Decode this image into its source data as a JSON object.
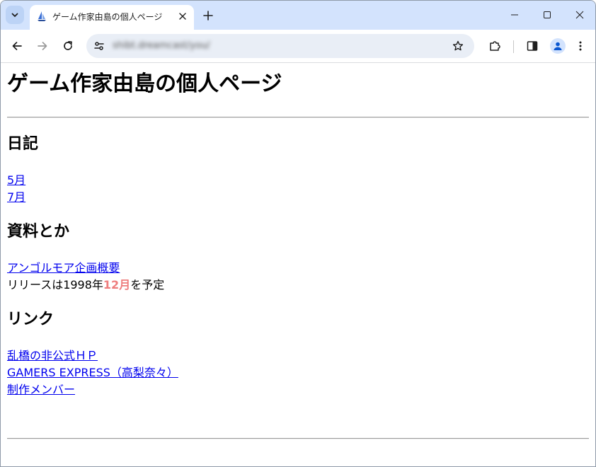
{
  "browser": {
    "tab_title": "ゲーム作家由島の個人ページ",
    "url": "shibt.dreamcast/you/"
  },
  "page": {
    "title": "ゲーム作家由島の個人ページ",
    "sections": {
      "diary": {
        "heading": "日記",
        "links": [
          "5月",
          "7月"
        ]
      },
      "materials": {
        "heading": "資料とか",
        "link": "アンゴルモア企画概要",
        "release_prefix": "リリースは1998年",
        "release_highlight": "12月",
        "release_suffix": "を予定"
      },
      "links": {
        "heading": "リンク",
        "items": [
          "乱橋の非公式ＨＰ",
          "GAMERS EXPRESS（高梨奈々）",
          "制作メンバー"
        ]
      }
    }
  },
  "colors": {
    "tabstrip": "#d3e3fd",
    "link": "#0000ee",
    "highlight": "#ee7d7d"
  },
  "icons": {
    "tab_search": "chevron-down-icon",
    "favicon": "sailboat-icon",
    "close": "close-icon",
    "new_tab": "plus-icon",
    "back": "arrow-left-icon",
    "forward": "arrow-right-icon",
    "reload": "reload-icon",
    "site_info": "tune-icon",
    "bookmark": "star-icon",
    "extensions": "puzzle-icon",
    "side_panel": "side-panel-icon",
    "profile": "person-icon",
    "menu": "kebab-menu-icon"
  }
}
